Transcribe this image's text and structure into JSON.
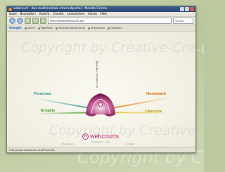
{
  "window": {
    "title": "webcourt - das multimediale Internetportal - Mozilla Firefox"
  },
  "menu": [
    "Datei",
    "Bearbeiten",
    "Ansicht",
    "Chronik",
    "Lesezeichen",
    "Extras",
    "Hilfe"
  ],
  "nav": {
    "url": "http://www.webcourts.de/",
    "search_placeholder": "Google"
  },
  "toolbar": {
    "google_label": "Google",
    "items": [
      "Suche",
      "PageRank",
      "Rechtschreibprüfung",
      "Übersetzen",
      "Optionen"
    ]
  },
  "page": {
    "vertical_word": [
      "W",
      "E",
      "B",
      "C",
      "O",
      "U",
      "R",
      "T",
      "S"
    ],
    "sections": [
      {
        "label": "Finanzen",
        "color": "#2f9a9a"
      },
      {
        "label": "Handwerk",
        "color": "#e07818"
      },
      {
        "label": "Kreativ",
        "color": "#4f9a2a"
      },
      {
        "label": "Lifestyle",
        "color": "#b8a018"
      }
    ],
    "logo_text": "webcourts",
    "logo_glyph": "w",
    "logo_tagline": "multimedia · web",
    "footer_links": [
      "Impressum",
      "Kontakt"
    ]
  },
  "status": {
    "text": "http://www.webcourts.de/#Finanzen"
  },
  "watermark_text": "Copyright by Creative-Creations",
  "colors": {
    "accent": "#c0307e",
    "titlebar": "#3a5a8c"
  }
}
